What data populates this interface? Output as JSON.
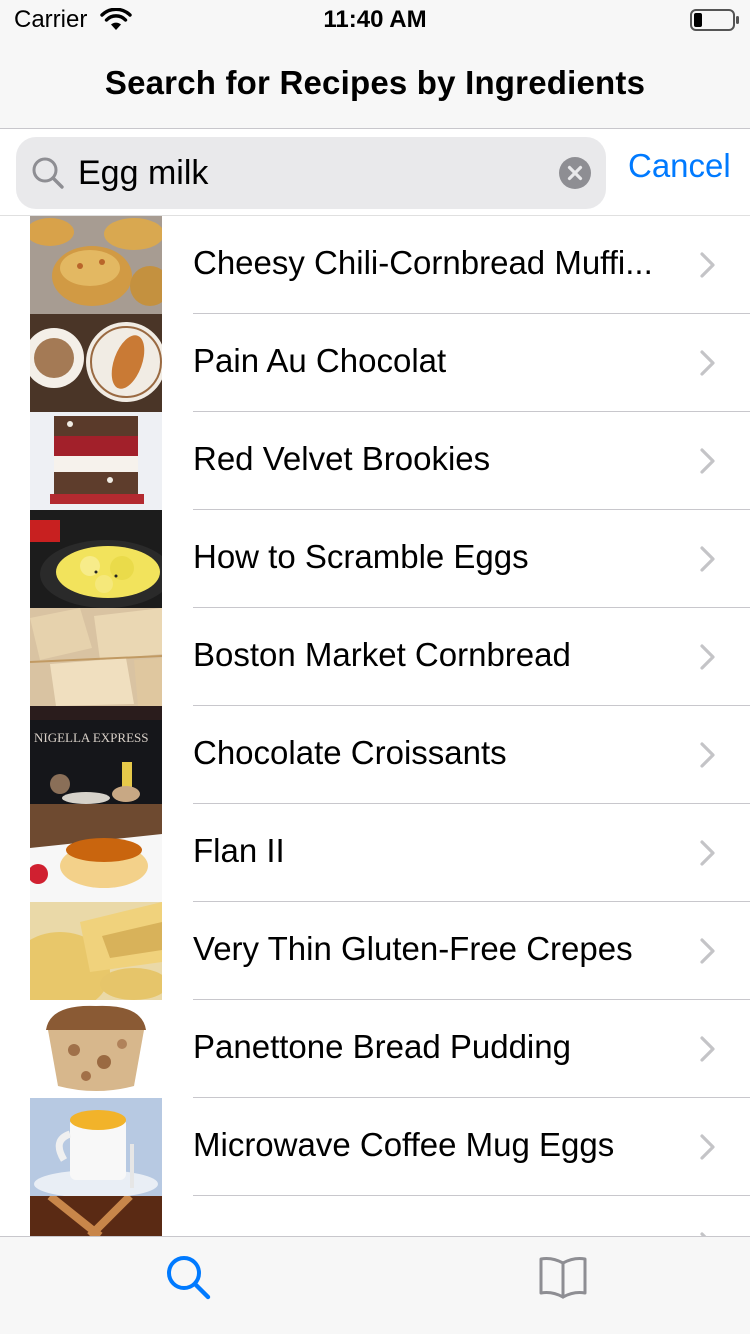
{
  "status_bar": {
    "carrier": "Carrier",
    "time": "11:40 AM"
  },
  "nav": {
    "title": "Search for Recipes by Ingredients"
  },
  "search": {
    "value": "Egg milk",
    "cancel_label": "Cancel"
  },
  "recipes": [
    {
      "name": "Cheesy Chili-Cornbread Muffi..."
    },
    {
      "name": "Pain Au Chocolat"
    },
    {
      "name": "Red Velvet Brookies"
    },
    {
      "name": "How to Scramble Eggs"
    },
    {
      "name": "Boston Market Cornbread"
    },
    {
      "name": "Chocolate Croissants",
      "thumb_text": "NIGELLA EXPRESS"
    },
    {
      "name": "Flan II"
    },
    {
      "name": "Very Thin Gluten-Free Crepes"
    },
    {
      "name": "Panettone Bread Pudding"
    },
    {
      "name": "Microwave Coffee Mug Eggs"
    }
  ],
  "tabs": [
    {
      "name": "search",
      "icon": "search-icon",
      "selected": true
    },
    {
      "name": "recipes",
      "icon": "book-icon",
      "selected": false
    }
  ],
  "colors": {
    "accent": "#007aff",
    "bar_background": "#f7f7f7",
    "search_field": "#e9e9eb",
    "separator": "#c8c7cc",
    "inactive_icon": "#8e8e93"
  }
}
